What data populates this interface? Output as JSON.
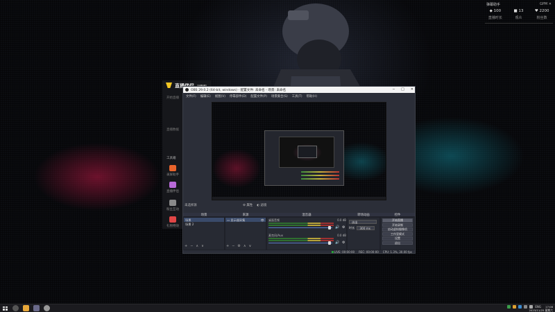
{
  "widget": {
    "title": "弹幕助手",
    "badge": "GPM",
    "close": "✕",
    "stats": [
      {
        "value": "◆ 100",
        "label": "直播时长"
      },
      {
        "value": "■ 13",
        "label": "观众"
      },
      {
        "value": "♥ 2200",
        "label": "粉丝数"
      }
    ]
  },
  "launcher": {
    "brand": "直播伴侣",
    "version_badge": "v2.6",
    "nav_items": [
      "开始直播",
      "直播数据"
    ],
    "tools_heading": "工具箱",
    "tools": [
      {
        "label": "录屏助手",
        "color": "#e8632b"
      },
      {
        "label": "直播伴侣",
        "color": "#b86ad8"
      },
      {
        "label": "粉丝互动",
        "color": "#8a8a8a"
      },
      {
        "label": "礼物特效",
        "color": "#e04646"
      }
    ]
  },
  "obs": {
    "title": "OBS 29.0.2 (64-bit, windows) - 配置文件: 未命名 - 场景: 未命名",
    "menu": [
      "文件(F)",
      "编辑(E)",
      "视图(V)",
      "停靠部件(D)",
      "配置文件(P)",
      "场景集合(S)",
      "工具(T)",
      "帮助(H)"
    ],
    "scene_bar": {
      "left": "未选择源",
      "props": "⚙ 属性",
      "filters": "◐ 滤镜"
    },
    "docks": {
      "scenes": {
        "title": "场景",
        "items": [
          "场景",
          "场景 2"
        ]
      },
      "sources": {
        "title": "来源",
        "items": [
          "显示器采集"
        ]
      },
      "mixer": {
        "title": "混音器",
        "tracks": [
          {
            "name": "桌面音频",
            "db": "0.0 dB"
          },
          {
            "name": "麦克风/Aux",
            "db": "0.0 dB"
          }
        ]
      },
      "transitions": {
        "title": "转场动画",
        "type": "淡出",
        "duration_label": "时长",
        "duration": "300 ms"
      },
      "controls": {
        "title": "控件",
        "buttons": [
          "开始直播",
          "开始录制",
          "启动虚拟摄像机",
          "工作室模式",
          "设置",
          "退出"
        ]
      }
    },
    "status": {
      "live": "LIVE: 00:00:00",
      "rec": "REC: 00:00:00",
      "cpu": "CPU: 1.3%, 30.00 fps"
    }
  },
  "taskbar": {
    "apps": [
      {
        "name": "search",
        "color": "#555"
      },
      {
        "name": "file-explorer",
        "color": "#e8a83a"
      },
      {
        "name": "obs",
        "color": "#6a6a8a"
      },
      {
        "name": "settings",
        "color": "#999"
      }
    ],
    "lang": "ENG",
    "time": "17:08",
    "date": "2023/11/25 星期六"
  }
}
